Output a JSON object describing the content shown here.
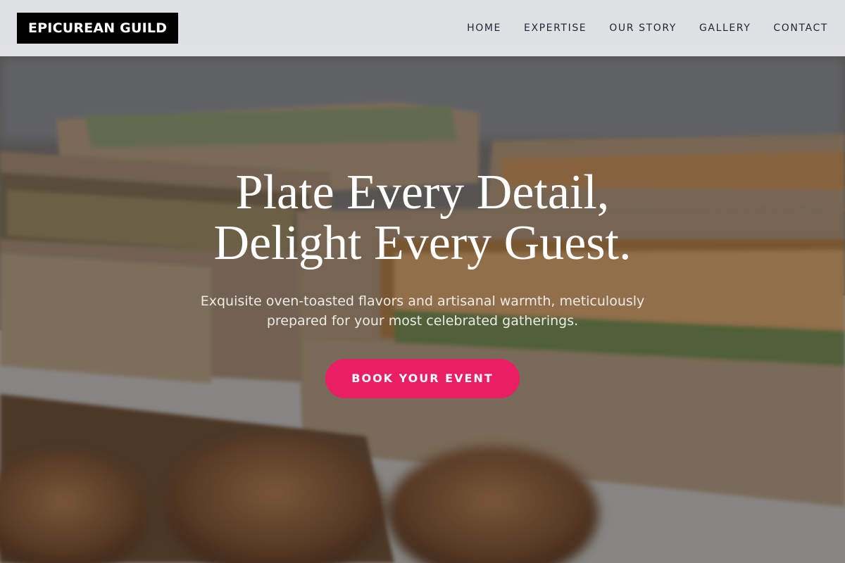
{
  "brand": {
    "name": "EPICUREAN GUILD"
  },
  "nav": {
    "items": [
      {
        "label": "HOME"
      },
      {
        "label": "EXPERTISE"
      },
      {
        "label": "OUR STORY"
      },
      {
        "label": "GALLERY"
      },
      {
        "label": "CONTACT"
      }
    ]
  },
  "hero": {
    "headline_line1": "Plate Every Detail,",
    "headline_line2": "Delight Every Guest.",
    "subtitle": "Exquisite oven-toasted flavors and artisanal warmth, meticulously prepared for your most celebrated gatherings.",
    "cta_label": "BOOK YOUR EVENT",
    "background_image": "catering-boxes-sandwiches-croissants-photo"
  },
  "colors": {
    "accent": "#e91e63",
    "logo_bg": "#000000",
    "header_bg": "#eceef0",
    "nav_text": "#1e2636"
  }
}
